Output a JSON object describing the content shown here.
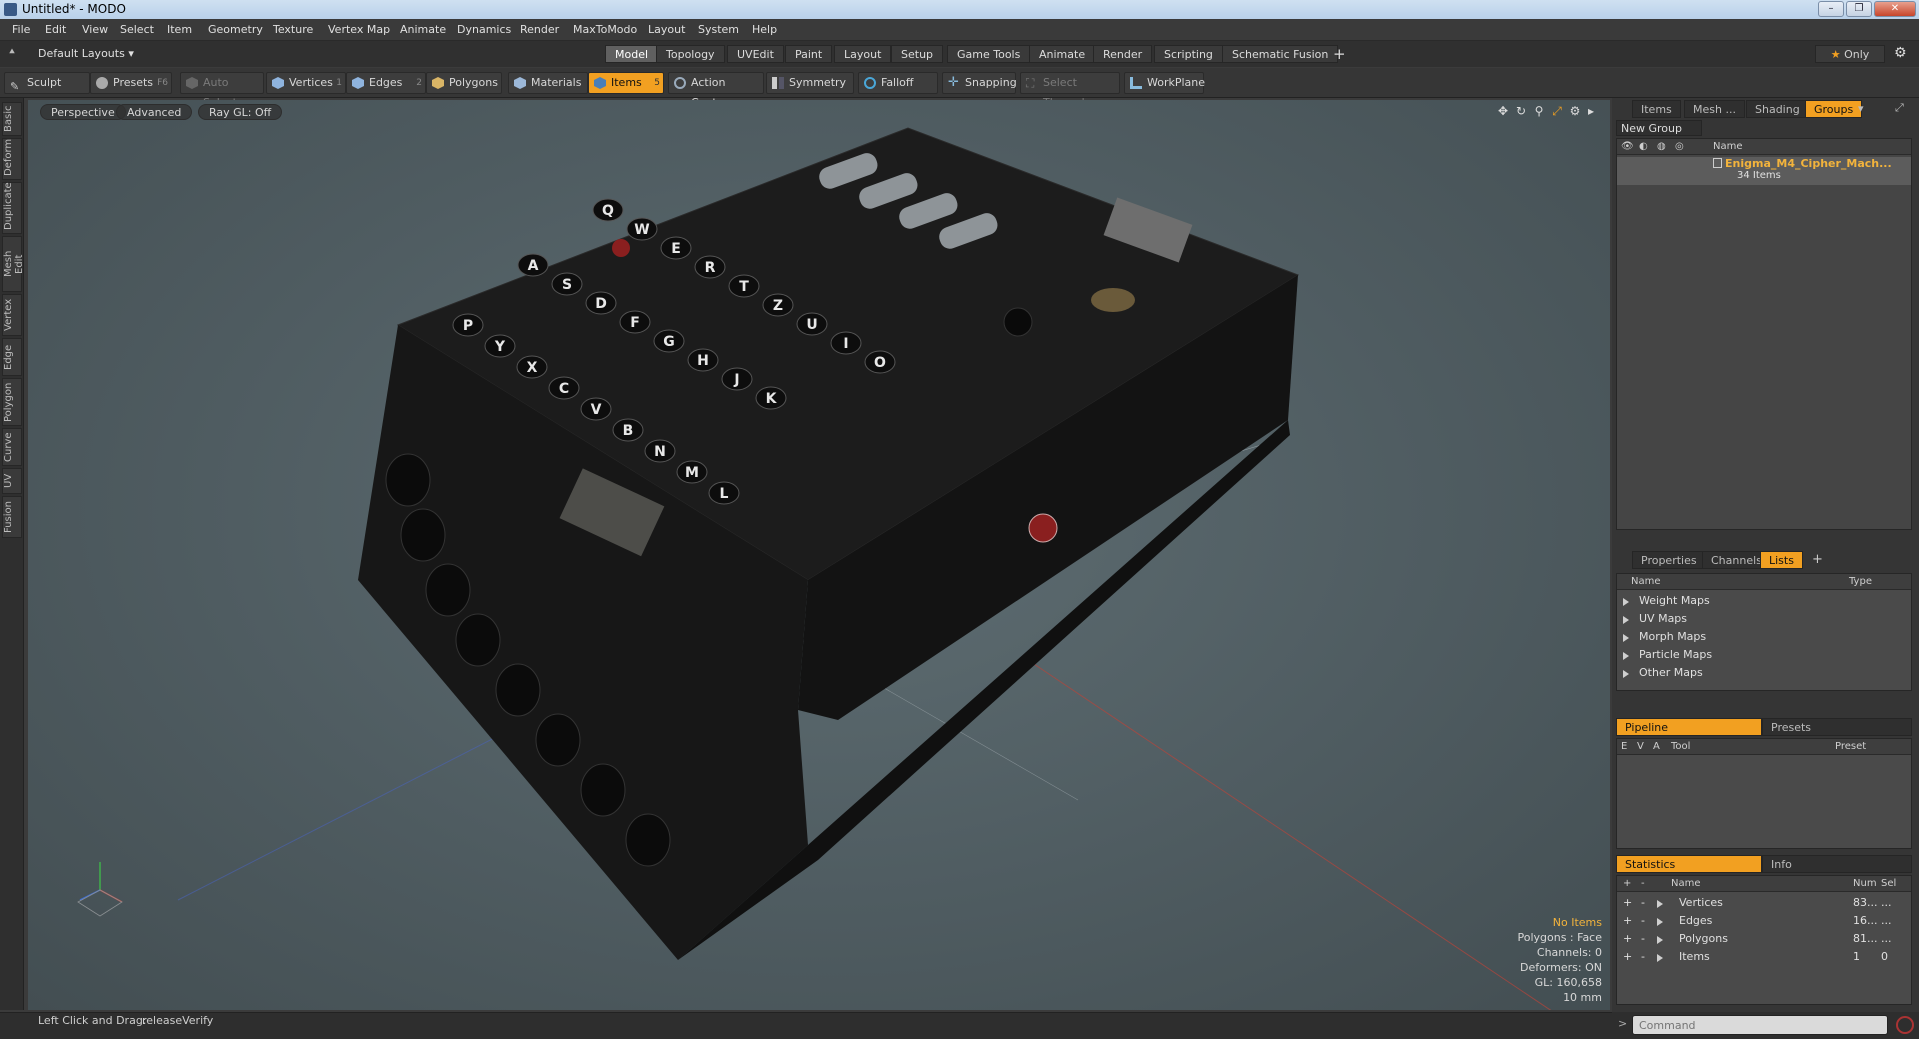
{
  "window": {
    "title": "Untitled* - MODO",
    "buttons": [
      "–",
      "❐",
      "✕"
    ]
  },
  "menu": [
    "File",
    "Edit",
    "View",
    "Select",
    "Item",
    "Geometry",
    "Texture",
    "Vertex Map",
    "Animate",
    "Dynamics",
    "Render",
    "MaxToModo",
    "Layout",
    "System",
    "Help"
  ],
  "layout_bar": {
    "layouts_label": "Default Layouts",
    "tabs": [
      "Model",
      "Topology",
      "UVEdit",
      "Paint",
      "Layout",
      "Setup",
      "Game Tools",
      "Animate",
      "Render",
      "Scripting",
      "Schematic Fusion"
    ],
    "active_tab": "Model",
    "add_label": "+",
    "only_label": "Only"
  },
  "toolbar": {
    "sculpt": "Sculpt",
    "presets": "Presets",
    "presets_key": "F6",
    "auto_select": "Auto Select",
    "vertices": "Vertices",
    "vertices_num": "1",
    "edges": "Edges",
    "edges_num": "2",
    "polygons": "Polygons",
    "materials": "Materials",
    "items": "Items",
    "items_num": "5",
    "action_center": "Action Center",
    "symmetry": "Symmetry",
    "falloff": "Falloff",
    "snapping": "Snapping",
    "select_through": "Select Through",
    "workplane": "WorkPlane"
  },
  "left_tabs": [
    "Basic",
    "Deform",
    "Duplicate",
    "Mesh Edit",
    "Vertex",
    "Edge",
    "Polygon",
    "Curve",
    "UV",
    "Fusion"
  ],
  "viewport": {
    "view_mode": "Perspective",
    "advanced": "Advanced",
    "raygl": "Ray GL: Off",
    "keys_row1": [
      "Q",
      "W",
      "E",
      "R",
      "T",
      "Z",
      "U",
      "I",
      "O"
    ],
    "keys_row2": [
      "A",
      "S",
      "D",
      "F",
      "G",
      "H",
      "J",
      "K"
    ],
    "keys_row3": [
      "P",
      "Y",
      "X",
      "C",
      "V",
      "B",
      "N",
      "M",
      "L"
    ],
    "stats": {
      "no_items": "No Items",
      "polygons": "Polygons : Face",
      "channels": "Channels: 0",
      "deformers": "Deformers: ON",
      "gl": "GL: 160,658",
      "scale": "10 mm"
    }
  },
  "groups_panel": {
    "tabs": [
      "Items",
      "Mesh ...",
      "Shading",
      "Groups"
    ],
    "active_tab": "Groups",
    "new_group": "New Group",
    "col_name": "Name",
    "group_name": "Enigma_M4_Cipher_Mach...",
    "group_count": "34 Items"
  },
  "lists_panel": {
    "tabs": [
      "Properties",
      "Channels",
      "Lists"
    ],
    "active_tab": "Lists",
    "add_label": "+",
    "col_name": "Name",
    "col_type": "Type",
    "rows": [
      "Weight Maps",
      "UV Maps",
      "Morph Maps",
      "Particle Maps",
      "Other Maps"
    ]
  },
  "pipeline_panel": {
    "tabs": [
      "Pipeline",
      "Presets"
    ],
    "active_tab": "Pipeline",
    "cols": [
      "E",
      "V",
      "A",
      "Tool",
      "Preset"
    ]
  },
  "statistics_panel": {
    "tabs": [
      "Statistics",
      "Info"
    ],
    "active_tab": "Statistics",
    "cols": [
      "+",
      "-",
      "Name",
      "Num",
      "Sel"
    ],
    "rows": [
      {
        "name": "Vertices",
        "num": "83...",
        "sel": "..."
      },
      {
        "name": "Edges",
        "num": "16...",
        "sel": "..."
      },
      {
        "name": "Polygons",
        "num": "81...",
        "sel": "..."
      },
      {
        "name": "Items",
        "num": "1",
        "sel": "0"
      }
    ]
  },
  "status": {
    "hint": "Left Click and Drag:",
    "action": "releaseVerify"
  },
  "command": {
    "placeholder": "Command"
  },
  "colors": {
    "accent": "#f2a021",
    "viewport_bg": "#55636a",
    "group_name": "#f2b33c"
  }
}
